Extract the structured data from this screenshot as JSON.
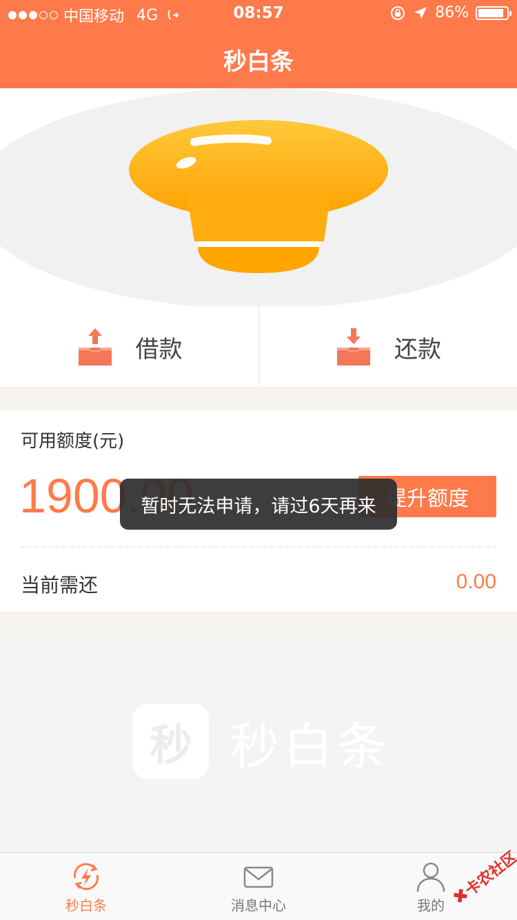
{
  "status_bar": {
    "carrier": "中国移动",
    "network": "4G",
    "time": "08:57",
    "battery": "86%"
  },
  "header": {
    "title": "秒白条"
  },
  "actions": {
    "borrow_label": "借款",
    "repay_label": "还款"
  },
  "credit": {
    "caption": "可用额度(元)",
    "amount": "1900.00",
    "raise_label": "提升额度",
    "due_label": "当前需还",
    "due_value": "0.00"
  },
  "toast": {
    "message": "暂时无法申请，请过6天再来"
  },
  "watermark": {
    "icon_text": "秒",
    "text": "秒白条"
  },
  "tabs": [
    {
      "label": "秒白条",
      "active": true
    },
    {
      "label": "消息中心",
      "active": false
    },
    {
      "label": "我的",
      "active": false
    }
  ],
  "corner_logo": {
    "text": "卡农社区"
  },
  "colors": {
    "accent": "#ff7a4a",
    "bulb": "#ffb21f"
  }
}
